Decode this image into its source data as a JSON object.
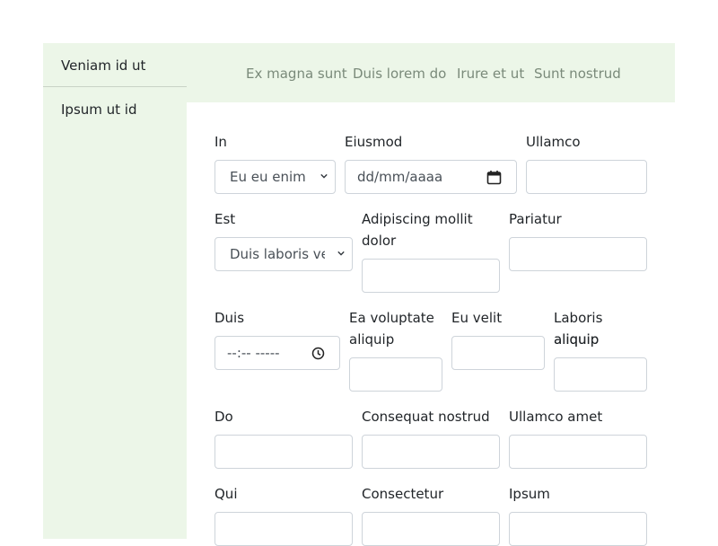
{
  "sidebar": {
    "items": [
      {
        "label": "Veniam id ut"
      },
      {
        "label": "Ipsum ut id"
      }
    ]
  },
  "topnav": {
    "tabs": [
      {
        "label": "Ex magna sunt"
      },
      {
        "label": "Duis lorem do"
      },
      {
        "label": "Irure et ut"
      },
      {
        "label": "Sunt nostrud"
      }
    ]
  },
  "form": {
    "in": {
      "label": "In",
      "value": "Eu eu enim"
    },
    "eiusmod": {
      "label": "Eiusmod",
      "placeholder": "dd/mm/aaaa"
    },
    "ullamco": {
      "label": "Ullamco",
      "value": ""
    },
    "est": {
      "label": "Est",
      "value": "Duis laboris veniam"
    },
    "adipiscing": {
      "label1": "Adipiscing mollit",
      "label2": "dolor",
      "value": ""
    },
    "pariatur": {
      "label": "Pariatur",
      "value": ""
    },
    "duis": {
      "label": "Duis",
      "placeholder": "--:-- -----"
    },
    "ea_voluptate": {
      "label1": "Ea voluptate",
      "label2": "aliquip",
      "value": ""
    },
    "eu_velit": {
      "label": "Eu velit",
      "value": ""
    },
    "laboris": {
      "label1": "Laboris aliquip",
      "label2": "aliquip",
      "value": ""
    },
    "do": {
      "label": "Do",
      "value": ""
    },
    "consequat": {
      "label": "Consequat nostrud",
      "value": ""
    },
    "ullamco_amet": {
      "label": "Ullamco amet",
      "value": ""
    },
    "qui": {
      "label": "Qui",
      "value": ""
    },
    "consectetur": {
      "label": "Consectetur",
      "value": ""
    },
    "ipsum": {
      "label": "Ipsum",
      "value": ""
    }
  },
  "colors": {
    "panel_bg": "#ecf6e8",
    "tab_text": "#7a8a7a",
    "border": "#ced4da"
  }
}
